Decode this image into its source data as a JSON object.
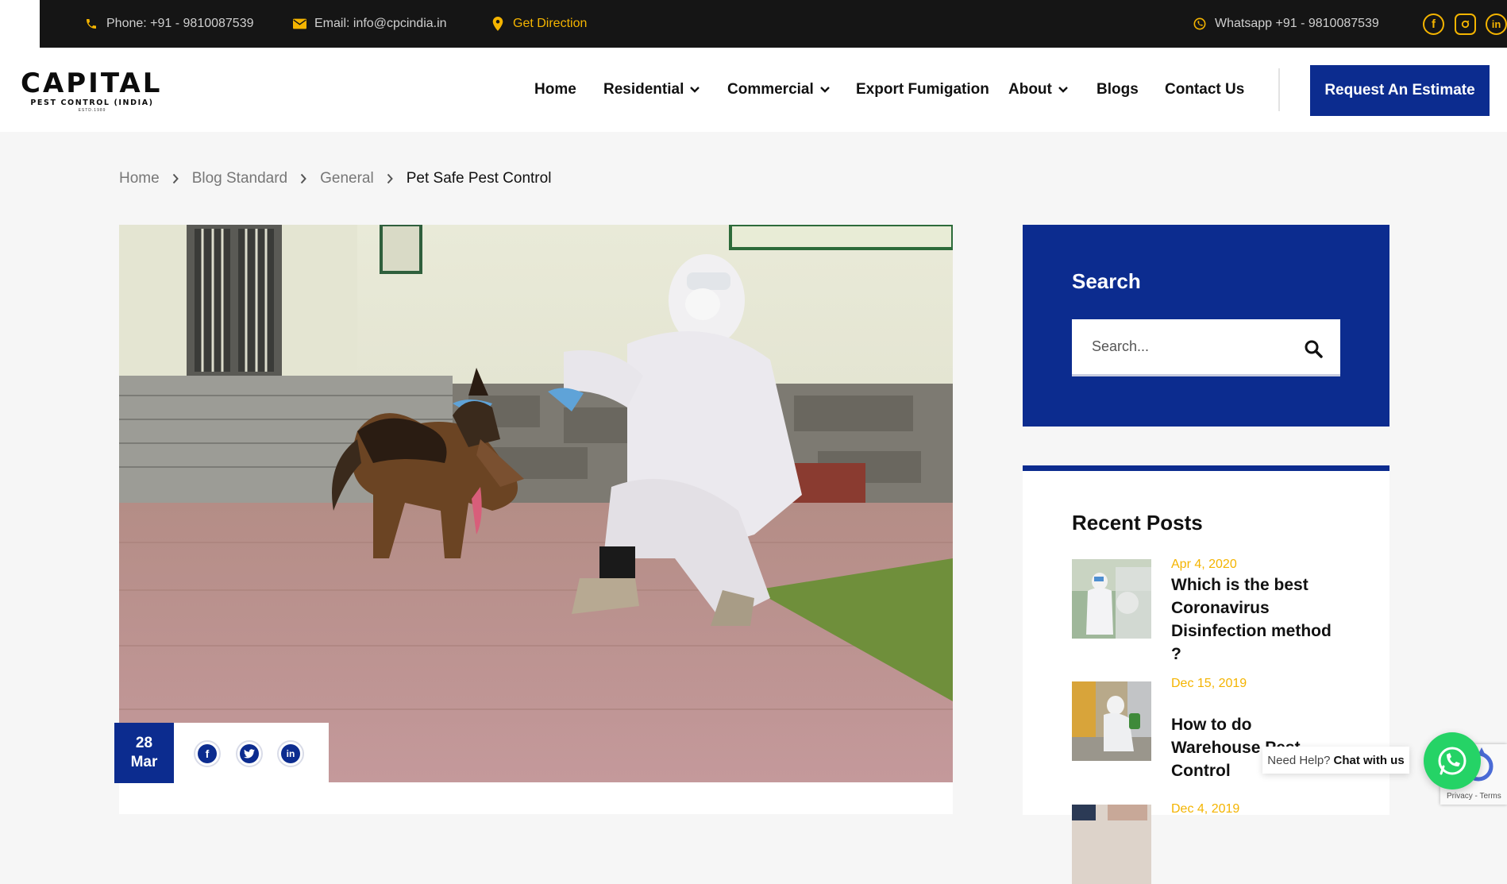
{
  "colors": {
    "brand": "#0c2c8f",
    "accent": "#f4b400",
    "topbar": "#151515",
    "whatsapp": "#25d366"
  },
  "topbar": {
    "phone": "Phone: +91 - 9810087539",
    "email": "Email: info@cpcindia.in",
    "direction": "Get Direction",
    "whatsapp": "Whatsapp +91 - 9810087539",
    "social_icons": [
      "facebook-icon",
      "instagram-icon",
      "linkedin-icon"
    ]
  },
  "logo": {
    "main": "CAPITAL",
    "sub": "PEST CONTROL (INDIA)",
    "est": "ESTD.1989"
  },
  "nav": {
    "items": [
      {
        "label": "Home",
        "dropdown": false
      },
      {
        "label": "Residential",
        "dropdown": true
      },
      {
        "label": "Commercial",
        "dropdown": true
      },
      {
        "label": "Export Fumigation",
        "dropdown": false
      },
      {
        "label": "About",
        "dropdown": true
      },
      {
        "label": "Blogs",
        "dropdown": false
      },
      {
        "label": "Contact Us",
        "dropdown": false
      }
    ],
    "cta": "Request An Estimate"
  },
  "breadcrumb": [
    "Home",
    "Blog Standard",
    "General",
    "Pet Safe Pest Control"
  ],
  "post": {
    "day": "28",
    "month": "Mar",
    "share_icons": [
      "facebook-icon",
      "twitter-icon",
      "linkedin-icon"
    ]
  },
  "sidebar": {
    "search": {
      "title": "Search",
      "placeholder": "Search..."
    },
    "recent": {
      "title": "Recent Posts",
      "posts": [
        {
          "date": "Apr 4, 2020",
          "title": "Which is the best Coronavirus Disinfection method ?"
        },
        {
          "date": "Dec 15, 2019",
          "title": "How to do Warehouse Pest Control"
        },
        {
          "date": "Dec 4, 2019",
          "title": ""
        }
      ]
    }
  },
  "widgets": {
    "help_text": "Need Help?",
    "help_bold": "Chat with us",
    "recaptcha": "Privacy - Terms"
  }
}
